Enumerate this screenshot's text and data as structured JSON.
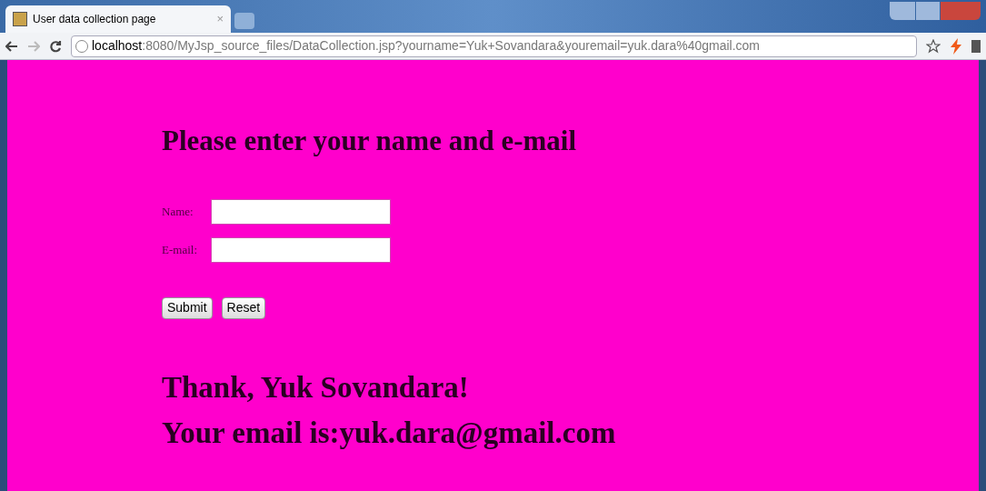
{
  "browser": {
    "tab": {
      "title": "User data collection page",
      "close": "×"
    },
    "address": {
      "host": "localhost",
      "rest": ":8080/MyJsp_source_files/DataCollection.jsp?yourname=Yuk+Sovandara&youremail=yuk.dara%40gmail.com"
    }
  },
  "page": {
    "heading": "Please enter your name and e-mail",
    "fields": [
      {
        "label": "Name:"
      },
      {
        "label": "E-mail:"
      }
    ],
    "buttons": [
      "Submit",
      "Reset"
    ],
    "result": [
      "Thank, Yuk Sovandara!",
      "Your email is:yuk.dara@gmail.com"
    ]
  }
}
